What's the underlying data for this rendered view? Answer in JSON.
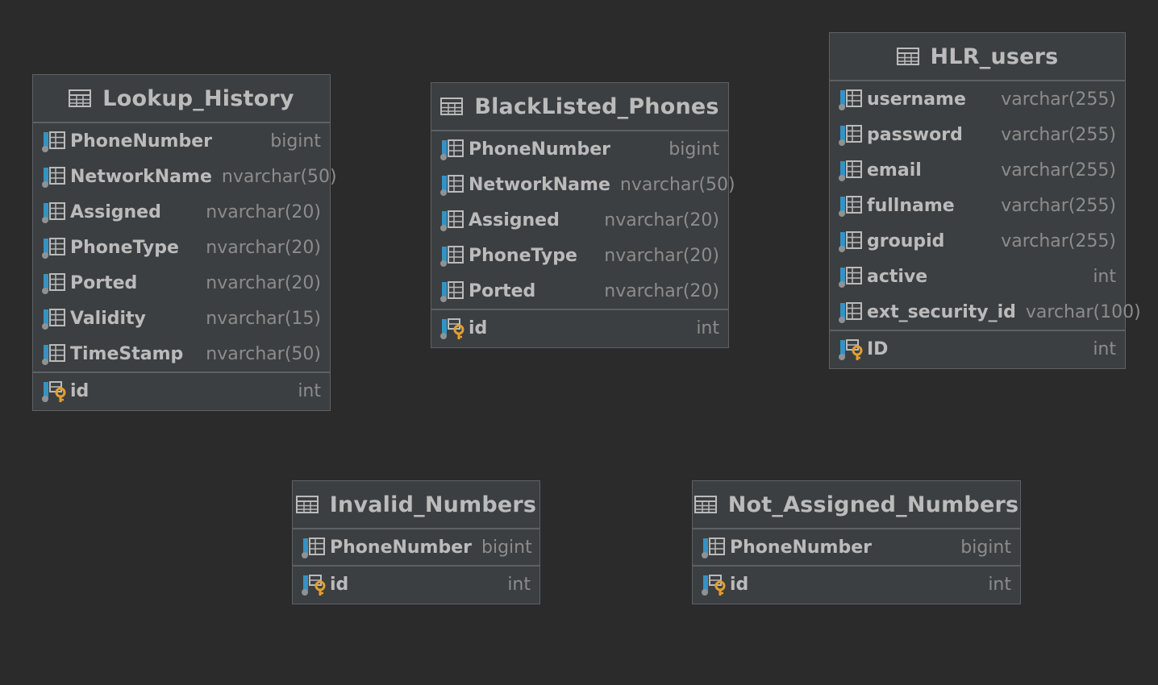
{
  "tables": {
    "lookup_history": {
      "name": "Lookup_History",
      "columns": [
        {
          "name": "PhoneNumber",
          "type": "bigint"
        },
        {
          "name": "NetworkName",
          "type": "nvarchar(50)"
        },
        {
          "name": "Assigned",
          "type": "nvarchar(20)"
        },
        {
          "name": "PhoneType",
          "type": "nvarchar(20)"
        },
        {
          "name": "Ported",
          "type": "nvarchar(20)"
        },
        {
          "name": "Validity",
          "type": "nvarchar(15)"
        },
        {
          "name": "TimeStamp",
          "type": "nvarchar(50)"
        }
      ],
      "pk": {
        "name": "id",
        "type": "int"
      }
    },
    "blacklisted_phones": {
      "name": "BlackListed_Phones",
      "columns": [
        {
          "name": "PhoneNumber",
          "type": "bigint"
        },
        {
          "name": "NetworkName",
          "type": "nvarchar(50)"
        },
        {
          "name": "Assigned",
          "type": "nvarchar(20)"
        },
        {
          "name": "PhoneType",
          "type": "nvarchar(20)"
        },
        {
          "name": "Ported",
          "type": "nvarchar(20)"
        }
      ],
      "pk": {
        "name": "id",
        "type": "int"
      }
    },
    "hlr_users": {
      "name": "HLR_users",
      "columns": [
        {
          "name": "username",
          "type": "varchar(255)"
        },
        {
          "name": "password",
          "type": "varchar(255)"
        },
        {
          "name": "email",
          "type": "varchar(255)"
        },
        {
          "name": "fullname",
          "type": "varchar(255)"
        },
        {
          "name": "groupid",
          "type": "varchar(255)"
        },
        {
          "name": "active",
          "type": "int"
        },
        {
          "name": "ext_security_id",
          "type": "varchar(100)"
        }
      ],
      "pk": {
        "name": "ID",
        "type": "int"
      }
    },
    "invalid_numbers": {
      "name": "Invalid_Numbers",
      "columns": [
        {
          "name": "PhoneNumber",
          "type": "bigint"
        }
      ],
      "pk": {
        "name": "id",
        "type": "int"
      }
    },
    "not_assigned_numbers": {
      "name": "Not_Assigned_Numbers",
      "columns": [
        {
          "name": "PhoneNumber",
          "type": "bigint"
        }
      ],
      "pk": {
        "name": "id",
        "type": "int"
      }
    }
  },
  "icons": {
    "table": "table-icon",
    "column": "column-icon",
    "primary_key": "primary-key-column-icon"
  },
  "colors": {
    "background": "#2b2b2b",
    "table_body": "#3c3f41",
    "border": "#5e6163",
    "text": "#bbbbbb",
    "type_text": "#8c8c8c",
    "column_icon_accent": "#3592c4",
    "key_icon": "#e0a030"
  }
}
